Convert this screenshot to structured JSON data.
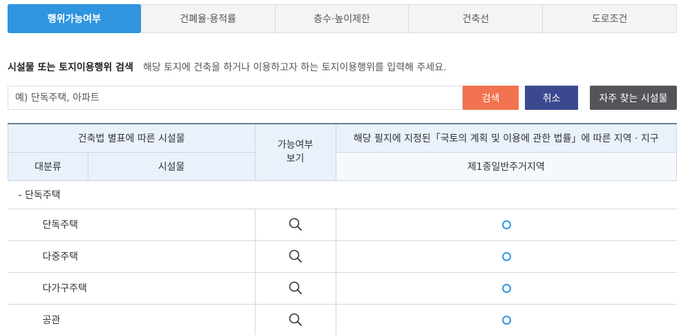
{
  "tabs": [
    {
      "label": "행위가능여부",
      "active": true
    },
    {
      "label": "건폐율·용적률",
      "active": false
    },
    {
      "label": "층수·높이제한",
      "active": false
    },
    {
      "label": "건축선",
      "active": false
    },
    {
      "label": "도로조건",
      "active": false
    }
  ],
  "search": {
    "title": "시설물 또는 토지이용행위 검색",
    "description": "해당 토지에 건축을 하거나 이용하고자 하는 토지이용행위를 입력해 주세요.",
    "placeholder": "예) 단독주택, 아파트",
    "search_label": "검색",
    "cancel_label": "취소",
    "frequent_label": "자주 찾는 시설물"
  },
  "table": {
    "header_facility_group": "건축법 별표에 따른 시설물",
    "header_possible": "가능여부 보기",
    "header_zone_group": "해당 필지에 지정된「국토의 계획 및 이용에 관한 법률」에 따른 지역 · 지구",
    "header_category": "대분류",
    "header_facility": "시설물",
    "header_zone": "제1종일반주거지역",
    "category_row": "- 단독주택",
    "rows": [
      {
        "name": "단독주택",
        "possible": "o"
      },
      {
        "name": "다중주택",
        "possible": "o"
      },
      {
        "name": "다가구주택",
        "possible": "o"
      },
      {
        "name": "공관",
        "possible": "o"
      }
    ]
  },
  "colors": {
    "accent": "#2f95df",
    "search_button": "#f2734f",
    "cancel_button": "#3b4a8f",
    "frequent_button": "#555559"
  }
}
